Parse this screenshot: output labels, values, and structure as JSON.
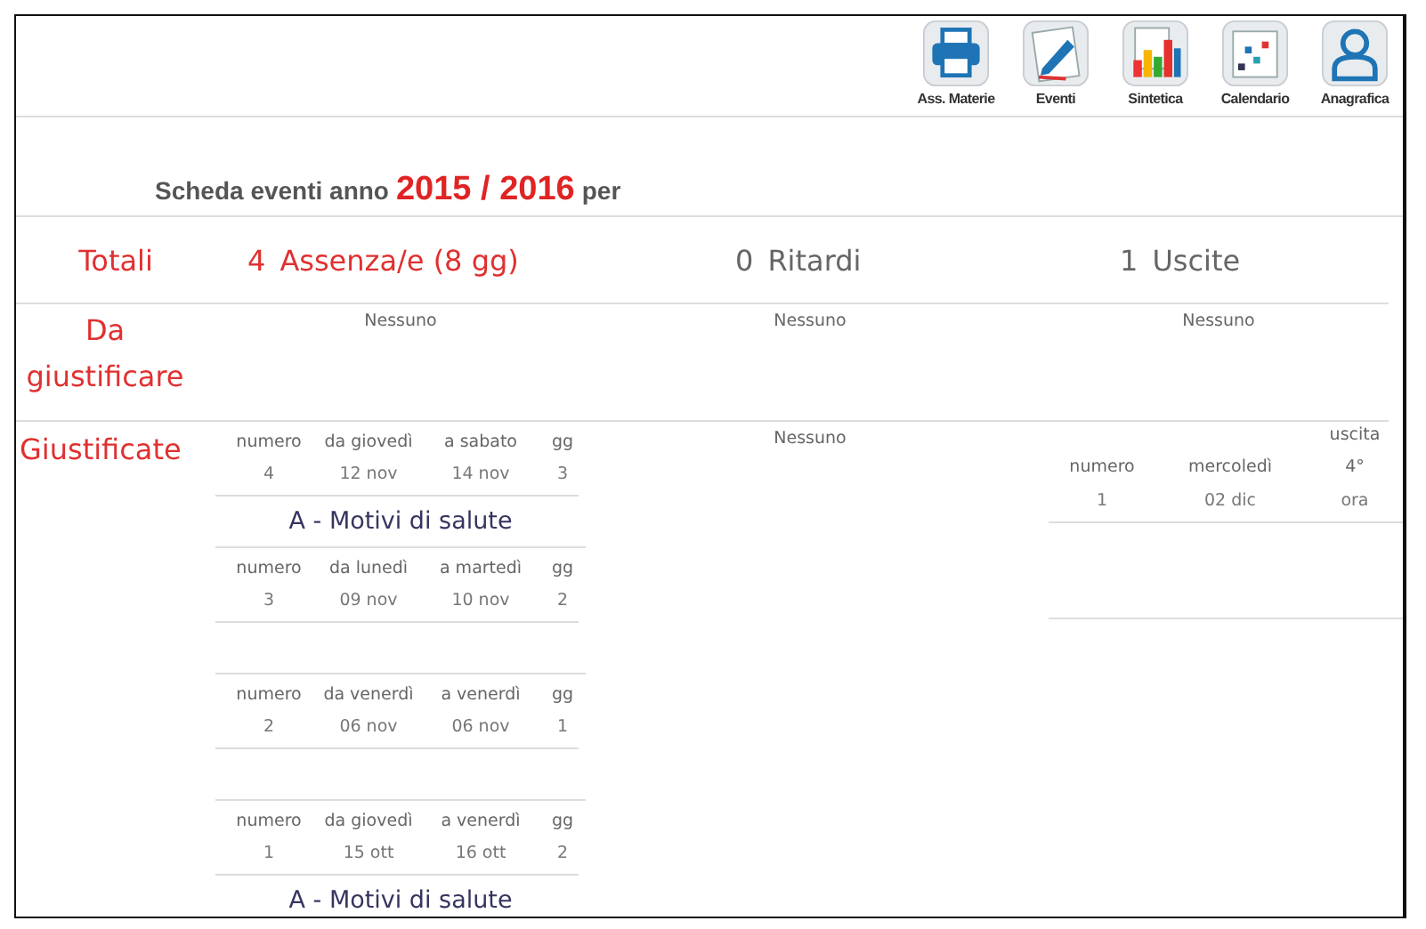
{
  "toolbar": [
    {
      "kind": "printer",
      "label": "Ass. Materie"
    },
    {
      "kind": "notepad",
      "label": "Eventi"
    },
    {
      "kind": "chart",
      "label": "Sintetica"
    },
    {
      "kind": "calendar",
      "label": "Calendario"
    },
    {
      "kind": "person",
      "label": "Anagrafica"
    }
  ],
  "title": {
    "lead": "Scheda eventi anno",
    "year": "2015 / 2016",
    "per": "per"
  },
  "totals": {
    "label": "Totali",
    "absences": {
      "count": "4",
      "text": "Assenza/e (8 gg)"
    },
    "delays": {
      "count": "0",
      "text": "Ritardi"
    },
    "exits": {
      "count": "1",
      "text": "Uscite"
    }
  },
  "to_justify": {
    "label": "Da giustificare",
    "columns": [
      "Nessuno",
      "Nessuno",
      "Nessuno"
    ]
  },
  "justified": {
    "label": "Giustificate",
    "absences": [
      {
        "headers": [
          "numero",
          "da giovedì",
          "a sabato",
          "gg"
        ],
        "values": [
          "4",
          "12 nov",
          "14 nov",
          "3"
        ],
        "reason": "A - Motivi di salute"
      },
      {
        "headers": [
          "numero",
          "da lunedì",
          "a martedì",
          "gg"
        ],
        "values": [
          "3",
          "09 nov",
          "10 nov",
          "2"
        ]
      },
      {
        "headers": [
          "numero",
          "da venerdì",
          "a venerdì",
          "gg"
        ],
        "values": [
          "2",
          "06 nov",
          "06 nov",
          "1"
        ]
      },
      {
        "headers": [
          "numero",
          "da giovedì",
          "a venerdì",
          "gg"
        ],
        "values": [
          "1",
          "15 ott",
          "16 ott",
          "2"
        ],
        "reason": "A - Motivi di salute"
      }
    ],
    "delays": "Nessuno",
    "exits": [
      {
        "number_label": "numero",
        "day_label": "mercoledì",
        "exit_label": "uscita",
        "hour": "4°",
        "number": "1",
        "date": "02 dic",
        "hour_unit": "ora"
      }
    ]
  }
}
